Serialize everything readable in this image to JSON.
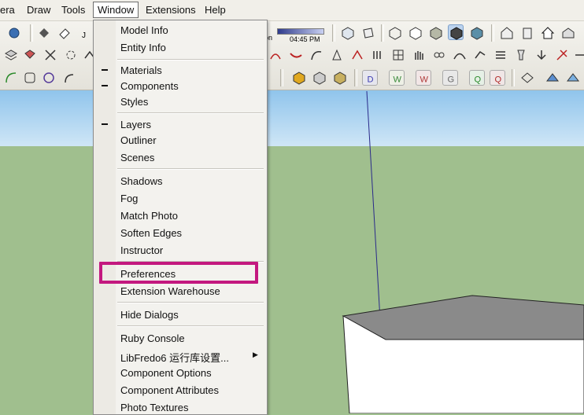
{
  "menubar": {
    "items": [
      {
        "label": "era"
      },
      {
        "label": "Draw"
      },
      {
        "label": "Tools"
      },
      {
        "label": "Window"
      },
      {
        "label": "Extensions"
      },
      {
        "label": "Help"
      }
    ]
  },
  "toolbar": {
    "shadow_on_label": "on",
    "shadow_time": "04:45 PM",
    "j_label": "J",
    "plugin_letters": [
      "D",
      "W",
      "W",
      "G",
      "Q",
      "Q"
    ]
  },
  "window_menu": {
    "items": [
      {
        "label": "Model Info",
        "checked": false
      },
      {
        "label": "Entity Info",
        "checked": false
      },
      {
        "label": "Materials",
        "checked": true
      },
      {
        "label": "Components",
        "checked": true
      },
      {
        "label": "Styles",
        "checked": false
      },
      {
        "label": "Layers",
        "checked": true
      },
      {
        "label": "Outliner",
        "checked": false
      },
      {
        "label": "Scenes",
        "checked": false
      },
      {
        "label": "Shadows",
        "checked": false
      },
      {
        "label": "Fog",
        "checked": false
      },
      {
        "label": "Match Photo",
        "checked": false
      },
      {
        "label": "Soften Edges",
        "checked": false
      },
      {
        "label": "Instructor",
        "checked": false
      },
      {
        "label": "Preferences",
        "checked": false,
        "highlighted": true
      },
      {
        "label": "Extension Warehouse",
        "checked": false
      },
      {
        "label": "Hide Dialogs",
        "checked": false
      },
      {
        "label": "Ruby Console",
        "checked": false
      },
      {
        "label": "LibFredo6 运行库设置...",
        "checked": false,
        "submenu": true
      },
      {
        "label": "Component Options",
        "checked": false
      },
      {
        "label": "Component Attributes",
        "checked": false
      },
      {
        "label": "Photo Textures",
        "checked": false
      }
    ]
  },
  "colors": {
    "highlight": "#c3187f",
    "sky": "#8fc4ec",
    "ground": "#a0bf8e",
    "box_top": "#8a8a8a",
    "box_side": "#ffffff"
  }
}
